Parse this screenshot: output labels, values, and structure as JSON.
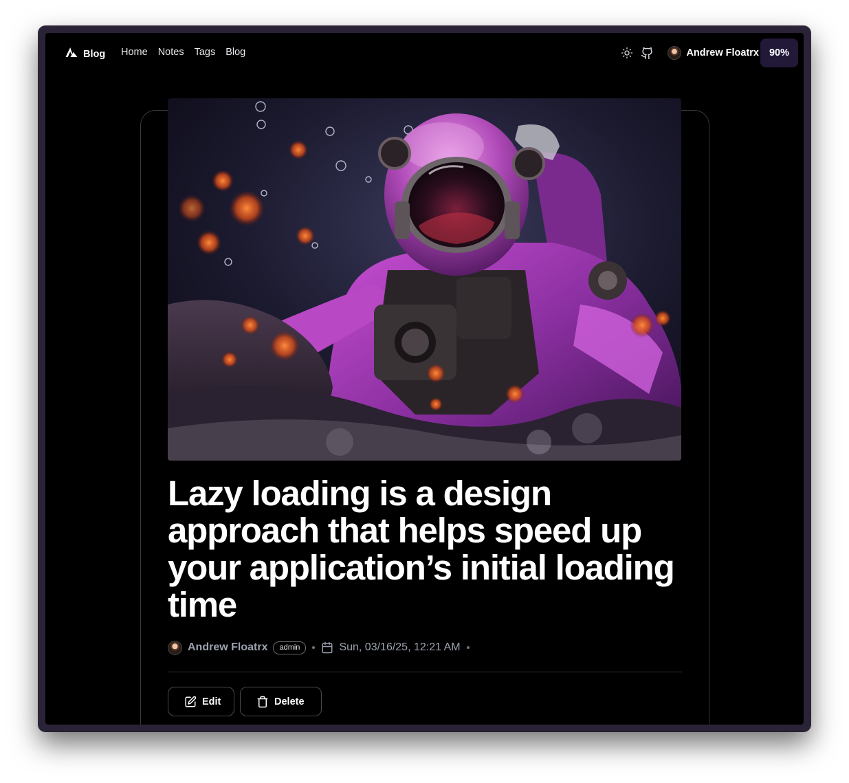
{
  "colors": {
    "background": "#000000",
    "frame": "#2a2236",
    "progress_badge_bg": "#221838",
    "muted_text": "#9ca3af",
    "border": "#3a3a3e"
  },
  "nav": {
    "brand": {
      "icon": "triangle-logo-icon",
      "label": "Blog"
    },
    "links": [
      "Home",
      "Notes",
      "Tags",
      "Blog"
    ],
    "theme_toggle_icon": "sun-icon",
    "github_icon": "github-icon",
    "user": {
      "name": "Andrew Floatrx",
      "avatar_icon": "avatar"
    },
    "reading_progress": "90%"
  },
  "article": {
    "hero_image": "astronaut-purple-suit-image",
    "title": "Lazy loading is a design approach that helps speed up your application’s initial loading time",
    "author": {
      "name": "Andrew Floatrx",
      "role": "admin"
    },
    "date_icon": "calendar-icon",
    "date": "Sun, 03/16/25, 12:21 AM"
  },
  "actions": {
    "edit_label": "Edit",
    "edit_icon": "pencil-square-icon",
    "delete_label": "Delete",
    "delete_icon": "trash-icon"
  }
}
